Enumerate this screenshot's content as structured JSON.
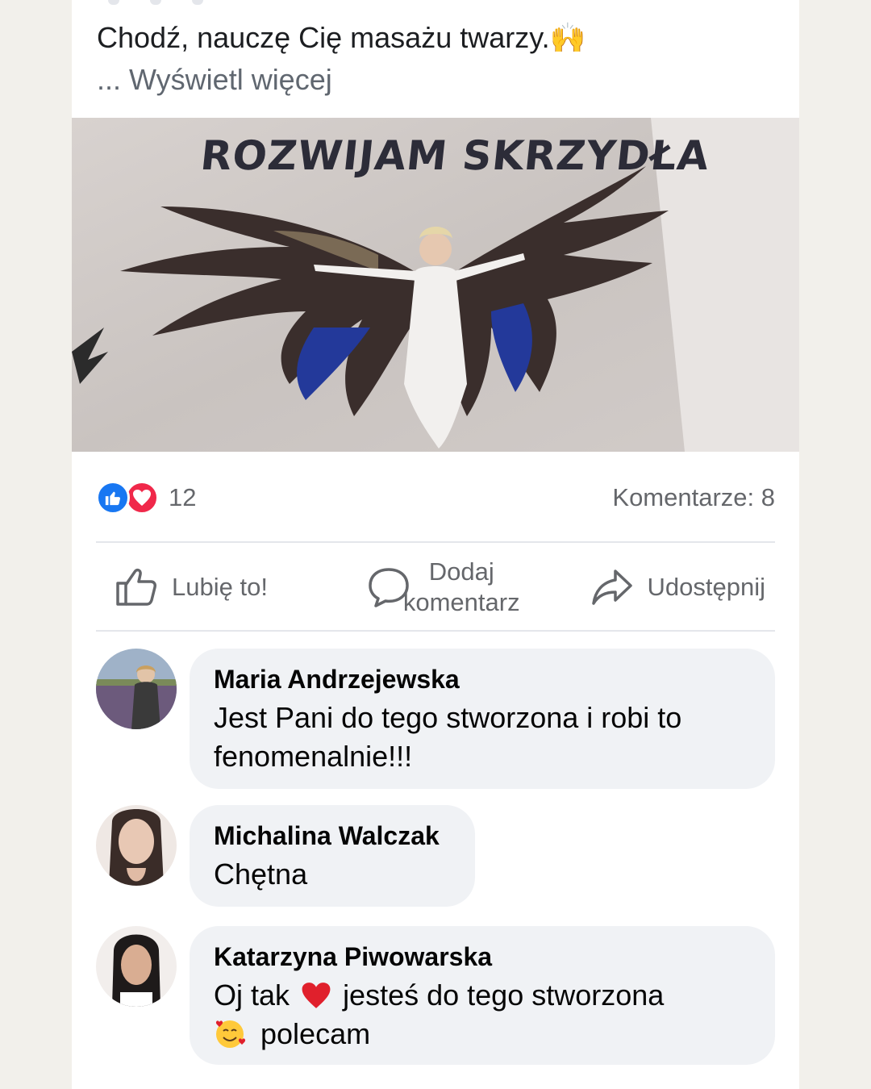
{
  "post": {
    "text": "Chodź, nauczę Cię masażu twarzy.🙌",
    "see_more": "... Wyświetl więcej",
    "photo_caption": "ROZWIJAM SKRZYDŁA"
  },
  "stats": {
    "reaction_count": "12",
    "comments_label": "Komentarze: 8"
  },
  "actions": {
    "like_label": "Lubię to!",
    "comment_label_line1": "Dodaj",
    "comment_label_line2": "komentarz",
    "share_label": "Udostępnij"
  },
  "comments": [
    {
      "name": "Maria Andrzejewska",
      "text_line1": "Jest Pani do tego stworzona i robi to",
      "text_line2": "fenomenalnie!!!"
    },
    {
      "name": "Michalina Walczak",
      "text": "Chętna"
    },
    {
      "name": "Katarzyna Piwowarska",
      "text_before": "Oj tak",
      "text_after": "jesteś do tego stworzona",
      "text_line2": "polecam"
    }
  ],
  "colors": {
    "like_blue": "#1877f2",
    "love_red": "#f0284a",
    "bubble_bg": "#f0f2f5",
    "meta_gray": "#65676b"
  }
}
